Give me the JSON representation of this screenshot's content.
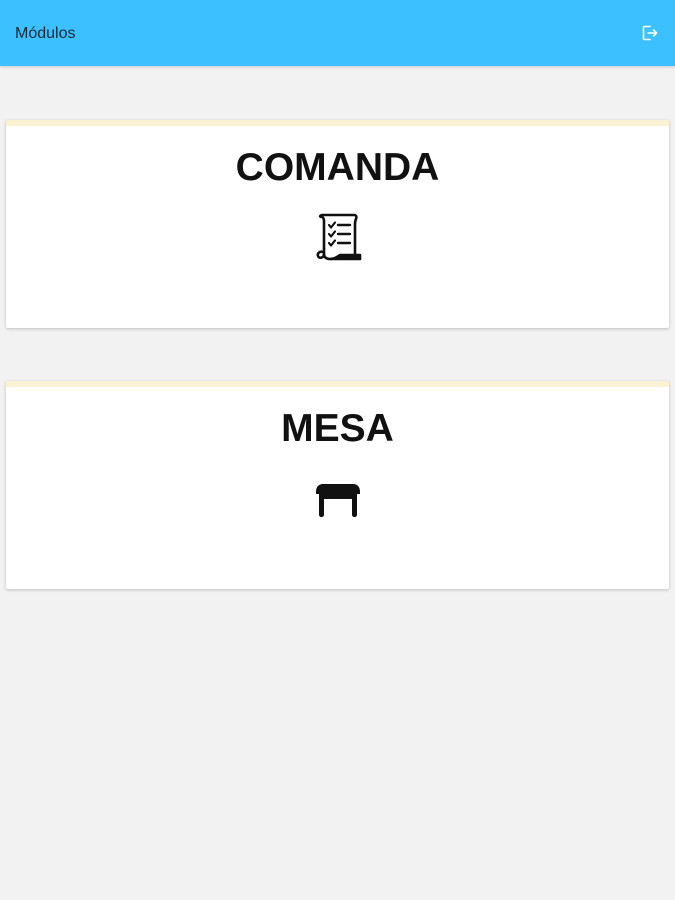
{
  "header": {
    "title": "Módulos",
    "logout_icon": "logout-icon",
    "background": "#3dc0ff"
  },
  "modules": [
    {
      "label": "COMANDA",
      "icon": "checklist-scroll-icon"
    },
    {
      "label": "MESA",
      "icon": "table-icon"
    }
  ],
  "colors": {
    "page_background": "#f2f2f2",
    "card_accent": "#fbf2d4",
    "card_background": "#ffffff"
  }
}
